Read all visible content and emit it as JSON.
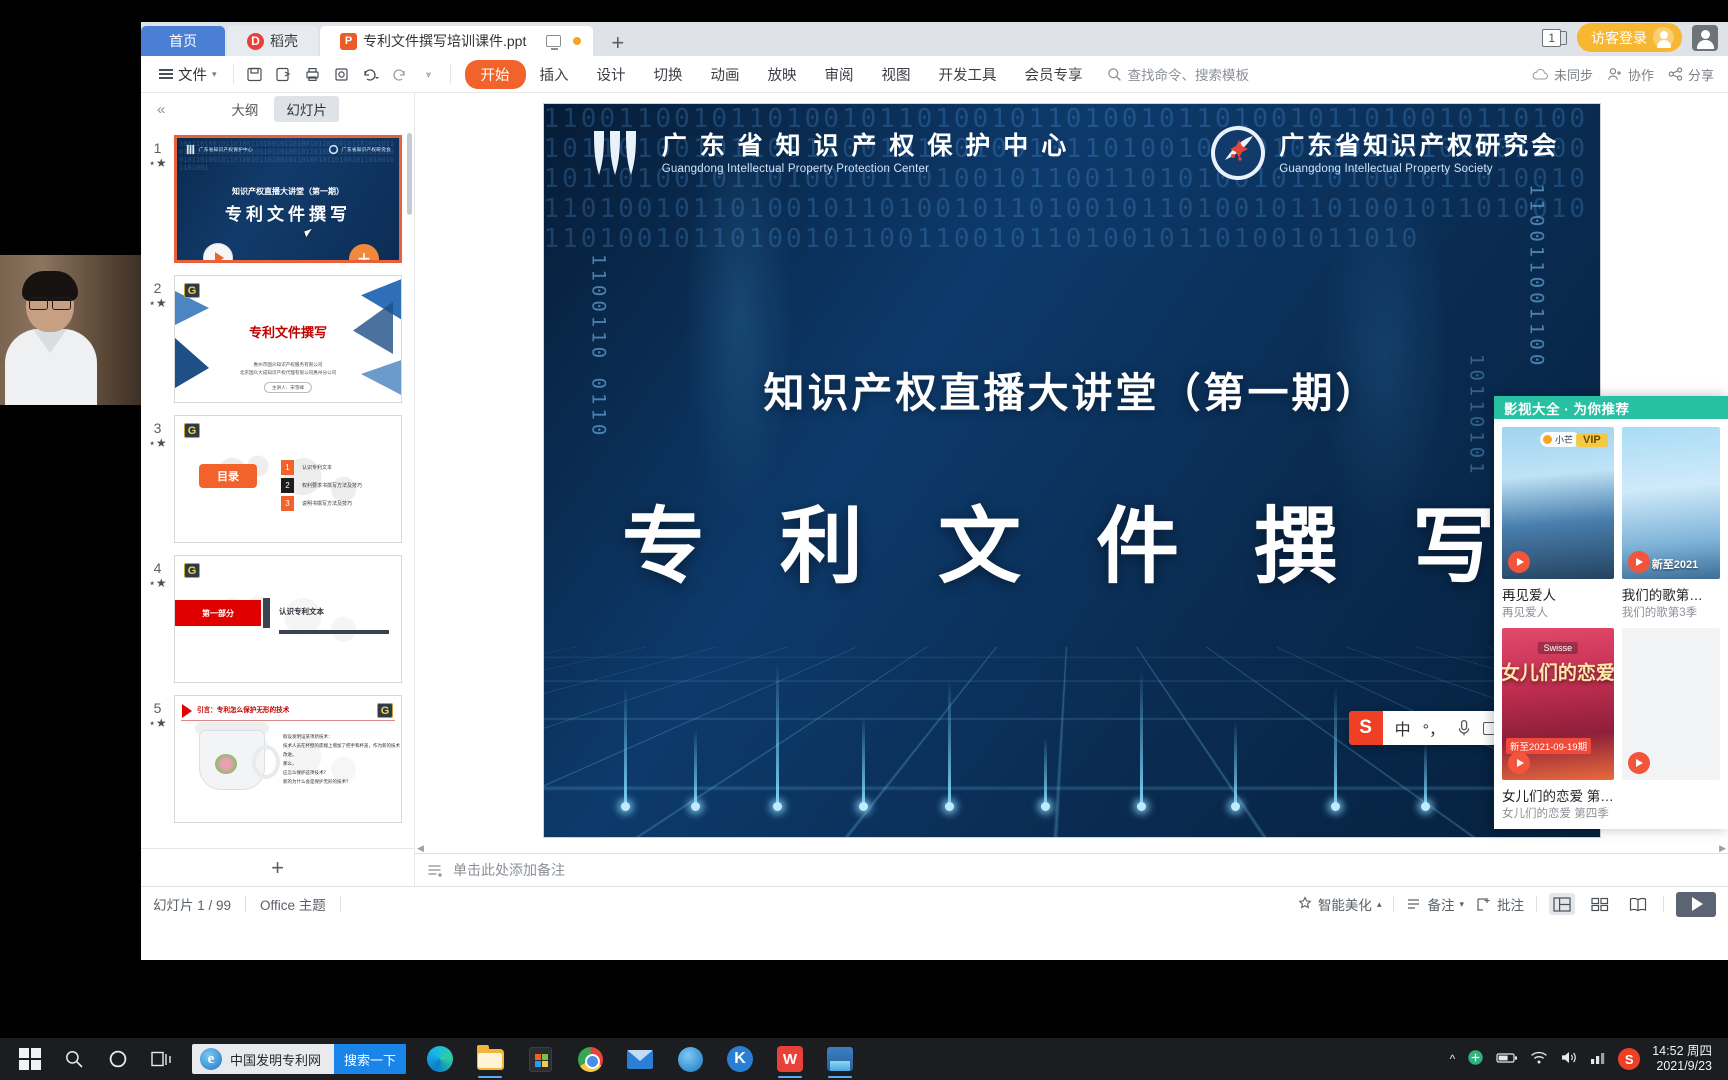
{
  "titlebar": {
    "tabs": [
      {
        "label": "首页",
        "icon": "home-tab"
      },
      {
        "label": "稻壳",
        "icon": "docer-icon"
      },
      {
        "label": "专利文件撰写培训课件.ppt",
        "icon": "ppt-file-icon"
      }
    ],
    "new_tab_label": "+",
    "page_count": "1",
    "login_label": "访客登录"
  },
  "ribbon": {
    "file_label": "文件",
    "quick_access": [
      "save-icon",
      "save-as-icon",
      "print-icon",
      "print-preview-icon",
      "undo-icon",
      "redo-icon",
      "customize-icon"
    ],
    "menus": [
      {
        "label": "开始",
        "active": true
      },
      {
        "label": "插入",
        "active": false
      },
      {
        "label": "设计",
        "active": false
      },
      {
        "label": "切换",
        "active": false
      },
      {
        "label": "动画",
        "active": false
      },
      {
        "label": "放映",
        "active": false
      },
      {
        "label": "审阅",
        "active": false
      },
      {
        "label": "视图",
        "active": false
      },
      {
        "label": "开发工具",
        "active": false
      },
      {
        "label": "会员专享",
        "active": false
      }
    ],
    "search_placeholder": "查找命令、搜索模板",
    "right_items": [
      {
        "label": "未同步",
        "icon": "cloud-sync-icon"
      },
      {
        "label": "协作",
        "icon": "collaborate-icon"
      },
      {
        "label": "分享",
        "icon": "share-icon"
      }
    ]
  },
  "slide_panel": {
    "collapse_label": "«",
    "tabs": [
      {
        "label": "大纲",
        "active": false
      },
      {
        "label": "幻灯片",
        "active": true
      }
    ],
    "add_slide_label": "+",
    "thumbnails": [
      {
        "num": "1",
        "selected": true,
        "title_sub": "知识产权直播大讲堂（第一期）",
        "title_main": "专利文件撰写",
        "org_left": "广东省知识产权保护中心",
        "org_right": "广东省知识产权研究会"
      },
      {
        "num": "2",
        "selected": false,
        "title": "专利文件撰写",
        "line1": "惠州市国众知识产权服务有限公司",
        "line2": "北京国众大成知识产权代理有限公司惠州分公司",
        "pill": "主讲人：宋雪峰"
      },
      {
        "num": "3",
        "selected": false,
        "button": "目录",
        "items": [
          {
            "n": "1",
            "text": "认识专利文本"
          },
          {
            "n": "2",
            "text": "权利要求书撰写方法及技巧"
          },
          {
            "n": "3",
            "text": "说明书撰写方法及技巧"
          }
        ]
      },
      {
        "num": "4",
        "selected": false,
        "badge": "第一部分",
        "heading": "认识专利文本"
      },
      {
        "num": "5",
        "selected": false,
        "heading": "引言：专利怎么保护无形的技术",
        "body": "假设发明设某项新技术：\n技术人员在杯壁的底端上增加了把手和杯盖，作为新的技术改进。\n那么，\n应怎么保护这项技术？\n新的为什么会是保护无形的技术？"
      }
    ]
  },
  "slide": {
    "org_left_cn": "广 东 省 知 识 产 权 保 护 中 心",
    "org_left_en": "Guangdong Intellectual Property Protection Center",
    "org_right_cn": "广东省知识产权研究会",
    "org_right_en": "Guangdong Intellectual Property Society",
    "subtitle": "知识产权直播大讲堂（第一期）",
    "title": "专 利 文 件 撰 写"
  },
  "ime": {
    "mode": "中",
    "punct": "°，",
    "icons": [
      "sogou-logo-icon",
      "mic-icon",
      "keyboard-icon",
      "toolbox-icon"
    ]
  },
  "notes": {
    "placeholder": "单击此处添加备注"
  },
  "statusbar": {
    "slide_count": "幻灯片 1 / 99",
    "theme": "Office 主题",
    "beautify": "智能美化",
    "notes": "备注",
    "comment": "批注",
    "views": [
      {
        "name": "normal-view",
        "active": true
      },
      {
        "name": "slide-sorter-view",
        "active": false
      },
      {
        "name": "reading-view",
        "active": false
      }
    ],
    "play": "play-slideshow"
  },
  "ad_panel": {
    "header": "影视大全 · 为你推荐",
    "cards": [
      {
        "title": "再见爱人",
        "subtitle": "再见爱人",
        "badge": "VIP",
        "brand": "小芒",
        "art": "ad1"
      },
      {
        "title": "我们的歌第…",
        "subtitle": "我们的歌第3季",
        "badge": "",
        "caption": "新至2021",
        "art": "ad2"
      },
      {
        "title": "女儿们的恋爱 第…",
        "subtitle": "女儿们的恋爱 第四季",
        "badge": "",
        "episode": "新至2021-09-19期",
        "brand": "Swisse",
        "art": "ad3",
        "art_title": "女儿们的恋爱"
      },
      {
        "title": "",
        "subtitle": "",
        "badge": "",
        "art": "ad4"
      }
    ]
  },
  "taskbar": {
    "start": "windows-start-icon",
    "search_icon": "taskbar-search-icon",
    "cortana_icon": "cortana-icon",
    "taskview_icon": "task-view-icon",
    "search_value": "中国发明专利网",
    "search_button": "搜索一下",
    "apps": [
      {
        "name": "edge-browser",
        "open": false
      },
      {
        "name": "file-explorer",
        "open": true
      },
      {
        "name": "microsoft-store",
        "open": false
      },
      {
        "name": "chrome-browser",
        "open": false
      },
      {
        "name": "mail-app",
        "open": false
      },
      {
        "name": "internet-explorer",
        "open": false
      },
      {
        "name": "kingsoft-app",
        "open": false
      },
      {
        "name": "wps-writer",
        "open": true
      },
      {
        "name": "wps-presentation",
        "open": true
      }
    ],
    "tray": [
      "show-hidden-icon",
      "ime-sogou-icon",
      "battery-icon",
      "wifi-icon",
      "volume-icon",
      "network-icon",
      "sogou-tray-icon"
    ],
    "clock_time": "14:52 周四",
    "clock_date": "2021/9/23"
  }
}
